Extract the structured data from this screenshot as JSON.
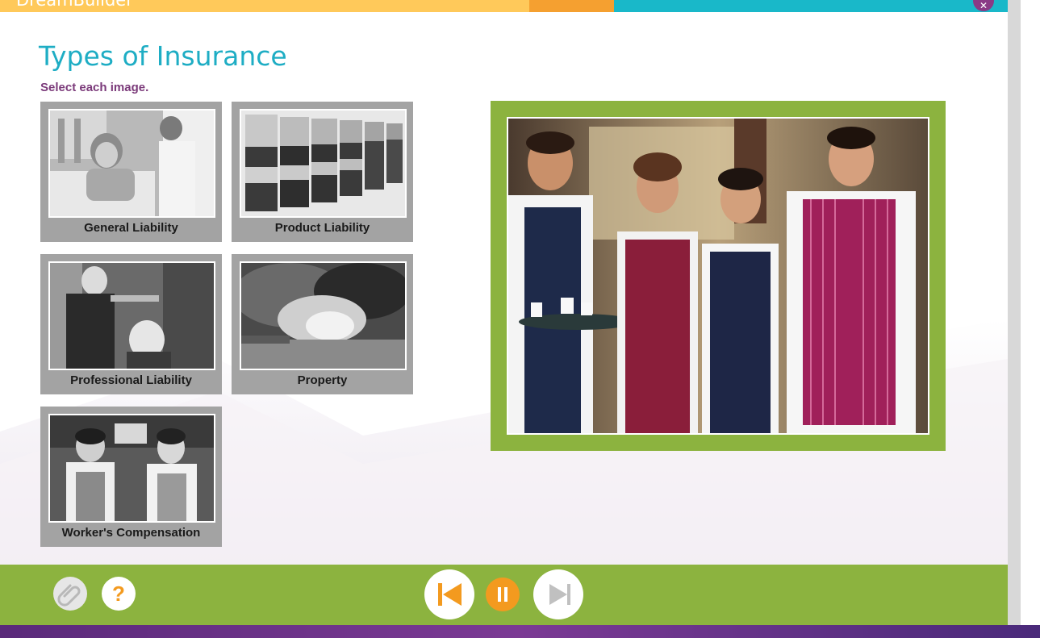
{
  "app": {
    "title": "DreamBuilder"
  },
  "page": {
    "title": "Types of Insurance",
    "instruction": "Select each image."
  },
  "tiles": [
    {
      "label": "General Liability"
    },
    {
      "label": "Product Liability"
    },
    {
      "label": "Professional Liability"
    },
    {
      "label": "Property"
    },
    {
      "label": "Worker's Compensation"
    }
  ],
  "controls": {
    "attachment_icon": "paperclip-icon",
    "help_icon": "question-mark-icon",
    "help_glyph": "?",
    "prev_icon": "skip-back-icon",
    "pause_icon": "pause-icon",
    "next_icon": "skip-forward-icon"
  },
  "colors": {
    "accent_teal": "#1eadc4",
    "accent_green": "#8cb33f",
    "accent_orange": "#f39a1f",
    "accent_purple": "#7b3a7a"
  }
}
